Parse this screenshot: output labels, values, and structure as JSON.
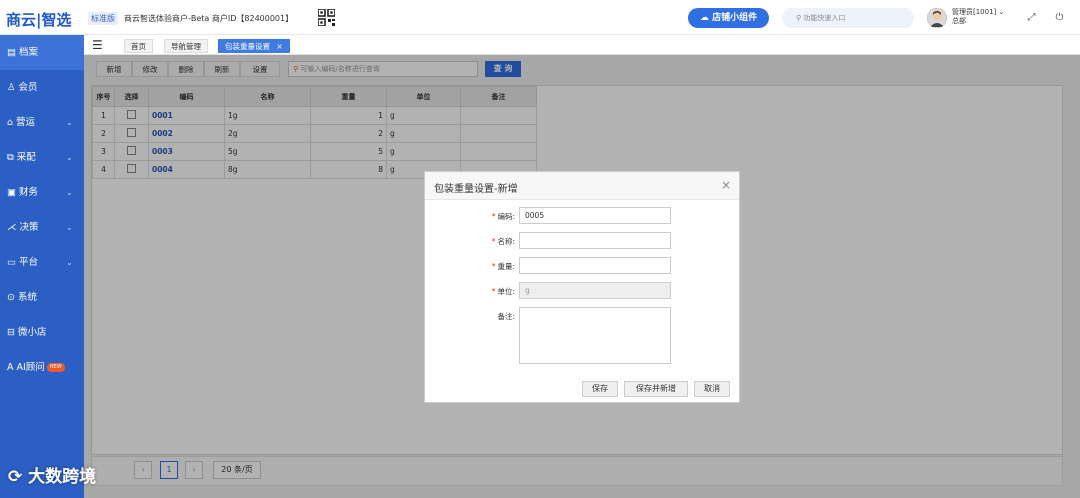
{
  "header": {
    "logo": "商云|智选",
    "edition": "标准版",
    "merchant": "商云智选体验商户-Beta  商户ID【82400001】",
    "shop_widget": "店铺小组件",
    "quick_search_placeholder": "功能快速入口",
    "user_line1": "管理员[1001] ⌄",
    "user_line2": "总部"
  },
  "sidebar": {
    "items": [
      {
        "label": "档案",
        "icon": "archive-icon"
      },
      {
        "label": "会员",
        "icon": "member-icon"
      },
      {
        "label": "营运",
        "icon": "operation-icon",
        "chev": "⌄"
      },
      {
        "label": "采配",
        "icon": "purchase-icon",
        "chev": "⌄"
      },
      {
        "label": "财务",
        "icon": "finance-icon",
        "chev": "⌄"
      },
      {
        "label": "决策",
        "icon": "decision-icon",
        "chev": "⌄"
      },
      {
        "label": "平台",
        "icon": "platform-icon",
        "chev": "⌄"
      },
      {
        "label": "系统",
        "icon": "system-icon"
      },
      {
        "label": "微小店",
        "icon": "microshop-icon"
      },
      {
        "label": "AI顾问",
        "icon": "ai-icon",
        "badge": "NEW"
      }
    ]
  },
  "tabs": [
    "首页",
    "导航管理",
    "包装重量设置"
  ],
  "tab_close": "×",
  "toolbar": {
    "buttons": [
      "新增",
      "修改",
      "删除",
      "刷新",
      "设置"
    ],
    "search_placeholder": "可输入编码/名称进行查询",
    "query": "查 询"
  },
  "table": {
    "headers": [
      "序号",
      "选择",
      "编码",
      "名称",
      "重量",
      "单位",
      "备注"
    ],
    "rows": [
      {
        "no": "1",
        "code": "0001",
        "name": "1g",
        "weight": "1",
        "unit": "g",
        "remark": ""
      },
      {
        "no": "2",
        "code": "0002",
        "name": "2g",
        "weight": "2",
        "unit": "g",
        "remark": ""
      },
      {
        "no": "3",
        "code": "0003",
        "name": "5g",
        "weight": "5",
        "unit": "g",
        "remark": ""
      },
      {
        "no": "4",
        "code": "0004",
        "name": "8g",
        "weight": "8",
        "unit": "g",
        "remark": ""
      }
    ]
  },
  "pager": {
    "current": "1",
    "page_size": "20 条/页"
  },
  "dialog": {
    "title": "包装重量设置-新增",
    "close": "×",
    "fields": {
      "code_label": "编码:",
      "code_value": "0005",
      "name_label": "名称:",
      "weight_label": "重量:",
      "unit_label": "单位:",
      "unit_value": "g",
      "remark_label": "备注:"
    },
    "required_mark": "*",
    "buttons": {
      "save": "保存",
      "save_new": "保存并新增",
      "cancel": "取消"
    }
  },
  "watermark": "大数跨境"
}
